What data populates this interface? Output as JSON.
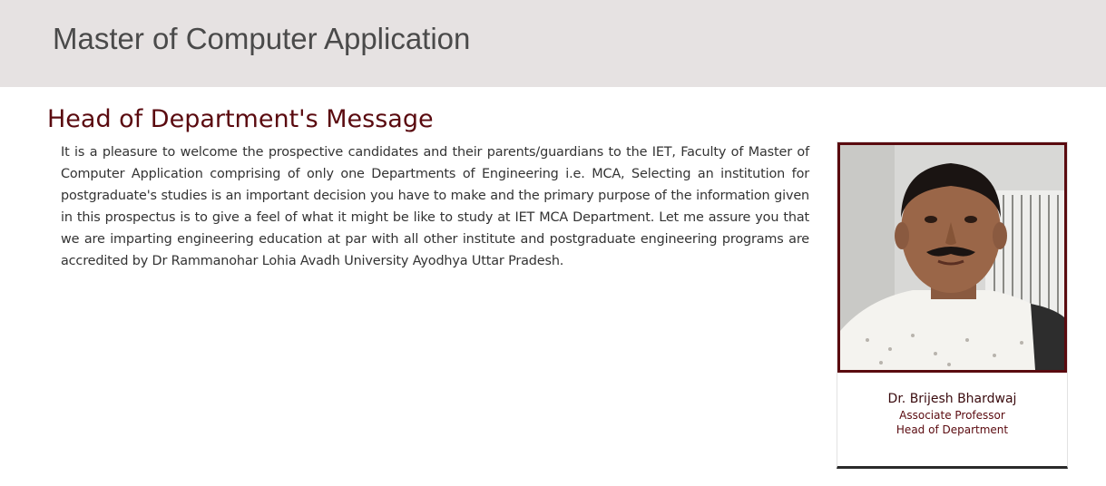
{
  "header": {
    "title": "Master of Computer Application"
  },
  "section": {
    "heading": "Head of Department's Message",
    "message": "It is a pleasure to welcome the prospective candidates and their parents/guardians to the IET, Faculty of Master of Computer Application comprising of only one Departments of Engineering i.e. MCA, Selecting an institution for postgraduate's studies is an important decision you have to make and the primary purpose of the information given in this prospectus is to give a feel of what it might be like to study at IET MCA Department. Let me assure you that we are imparting engineering education at par with all other institute and postgraduate engineering programs are accredited by Dr Rammanohar Lohia Avadh University Ayodhya Uttar Pradesh."
  },
  "profile": {
    "name": "Dr. Brijesh Bhardwaj",
    "designation": "Associate Professor",
    "role": "Head of Department"
  },
  "colors": {
    "header_bg": "#e6e2e2",
    "accent": "#5a0a0f"
  }
}
